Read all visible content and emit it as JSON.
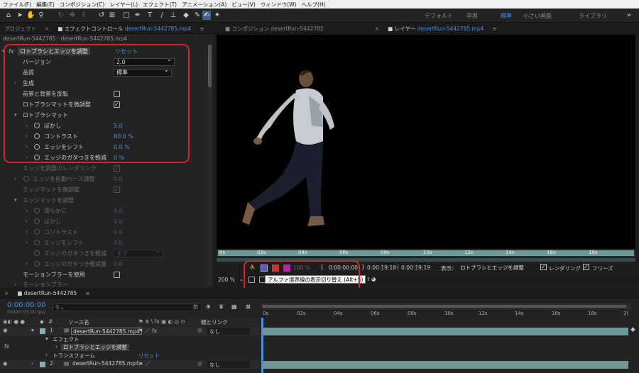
{
  "menu": [
    "ファイル(F)",
    "編集(E)",
    "コンポジション(C)",
    "レイヤー(L)",
    "エフェクト(T)",
    "アニメーション(A)",
    "ビュー(V)",
    "ウィンドウ(W)",
    "ヘルプ(H)"
  ],
  "workspaces": {
    "items": [
      "デフォルト",
      "学習",
      "標準",
      "小さい画面",
      "ライブラリ"
    ],
    "active": "標準"
  },
  "left_panel": {
    "tab_project": "プロジェクト",
    "tab_effect_prefix": "エフェクトコントロール",
    "tab_effect_file": "desertRun-5442785.mp4",
    "breadcrumb": "desertRun-5442785 · desertRun-5442785.mp4"
  },
  "effect": {
    "fx_label": "fx",
    "name": "ロトブラシとエッジを調整",
    "reset": "リセット",
    "rows": [
      {
        "label": "バージョン",
        "dropdown": "2.0"
      },
      {
        "label": "品質",
        "dropdown": "標準"
      },
      {
        "label": "生成"
      },
      {
        "label": "前景と背景を反転",
        "check": false
      },
      {
        "label": "ロトブラシマットを微調整",
        "check": true
      },
      {
        "label": "ロトブラシマット"
      },
      {
        "label": "ぼかし",
        "value": "5.0"
      },
      {
        "label": "コントラスト",
        "value": "80.0 %"
      },
      {
        "label": "エッジをシフト",
        "value": "0.0 %"
      },
      {
        "label": "エッジのガタつきを軽減",
        "value": "0 %"
      }
    ],
    "dim_rows": [
      {
        "label": "エッジを調整のレンダリング"
      },
      {
        "label": "エッジを自動ベース調整",
        "value": "0.0"
      },
      {
        "label": "エッジマットを微調整"
      },
      {
        "label": "エッジマットを調整"
      },
      {
        "label": "滑らかに",
        "value": "0.0"
      },
      {
        "label": "ぼかし",
        "value": "0.0"
      },
      {
        "label": "コントラスト",
        "value": "0.0"
      },
      {
        "label": "エッジをシフト",
        "value": "0.0"
      },
      {
        "label": "エッジのガタつきを軽減",
        "value": "オフ"
      },
      {
        "label": "エッジのガタつき軽減量",
        "value": "0.0"
      }
    ],
    "motion_blur": "モーションブラーを使用",
    "motion_blur_sub": "モーションブラー"
  },
  "viewer": {
    "tab_comp_prefix": "コンポジション",
    "tab_comp_name": "desertRun-5442785",
    "tab_layer_prefix": "レイヤー",
    "tab_layer_name": "desertRun-5442785.mp4",
    "ruler": [
      "0s",
      "02s",
      "04s",
      "06s",
      "08s",
      "10s",
      "12s",
      "14s",
      "16s",
      "18s"
    ],
    "zoom": "200 %",
    "alpha_pct": "100 %",
    "time_in": "0:00:00:00",
    "time_out": "0:00:19:18",
    "time_dur": "0:00:19:19",
    "view_label": "表示：",
    "view_value": "ロトブラシとエッジを調整",
    "render_label": "レンダリング",
    "freeze_label": "フリーズ",
    "tooltip": "アルファ境界線の表示切り替え (Alt+5)"
  },
  "timeline": {
    "tab": "desertRun-5442785",
    "timecode": "0:00:00:00",
    "timecode_sub": "00000 (25.00 fps)",
    "col_source": "ソース名",
    "col_parent": "親とリンク",
    "ruler": [
      "0s",
      "02s",
      "04s",
      "06s",
      "08s",
      "10s",
      "12s",
      "14s",
      "16s",
      "18s",
      "2("
    ],
    "layers": [
      {
        "num": "1",
        "name": "desertRun-5442785.mp4",
        "parent": "なし"
      },
      {
        "num": "2",
        "name": "desertRun-5442785.mp4",
        "parent": "なし"
      }
    ],
    "effects_label": "エフェクト",
    "effect_item": "ロトブラシとエッジを調整",
    "transform_label": "トランスフォーム",
    "transform_reset": "リセット"
  }
}
